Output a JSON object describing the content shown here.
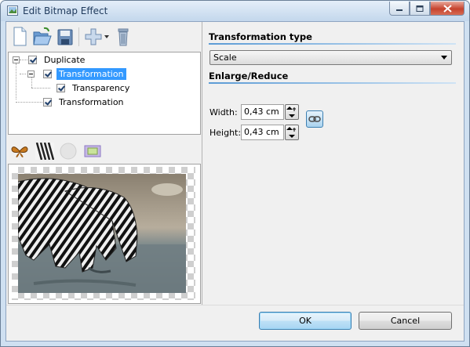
{
  "window": {
    "title": "Edit Bitmap Effect"
  },
  "icons": {
    "app": "bitmap-effect-icon",
    "new": "new-document-icon",
    "open": "open-folder-icon",
    "save": "save-disk-icon",
    "add": "add-plus-icon",
    "delete": "delete-trash-icon",
    "preview_tools": [
      "butterfly-icon",
      "zebra-icon",
      "circle-icon",
      "frame-icon"
    ],
    "link": "chain-link-icon"
  },
  "tree": {
    "items": [
      {
        "label": "Duplicate",
        "checked": true,
        "level": 0,
        "expanded": true
      },
      {
        "label": "Transformation",
        "checked": true,
        "level": 1,
        "selected": true,
        "expanded": true
      },
      {
        "label": "Transparency",
        "checked": true,
        "level": 2
      },
      {
        "label": "Transformation",
        "checked": true,
        "level": 1
      }
    ]
  },
  "panel": {
    "transform_type_heading": "Transformation type",
    "transform_type_value": "Scale",
    "enlarge_heading": "Enlarge/Reduce",
    "width_label": "Width:",
    "width_value": "0,43 cm",
    "height_label": "Height:",
    "height_value": "0,43 cm"
  },
  "buttons": {
    "ok": "OK",
    "cancel": "Cancel"
  },
  "colors": {
    "selection": "#3399ff",
    "accent": "#5b9bd5",
    "close": "#c6432d"
  }
}
